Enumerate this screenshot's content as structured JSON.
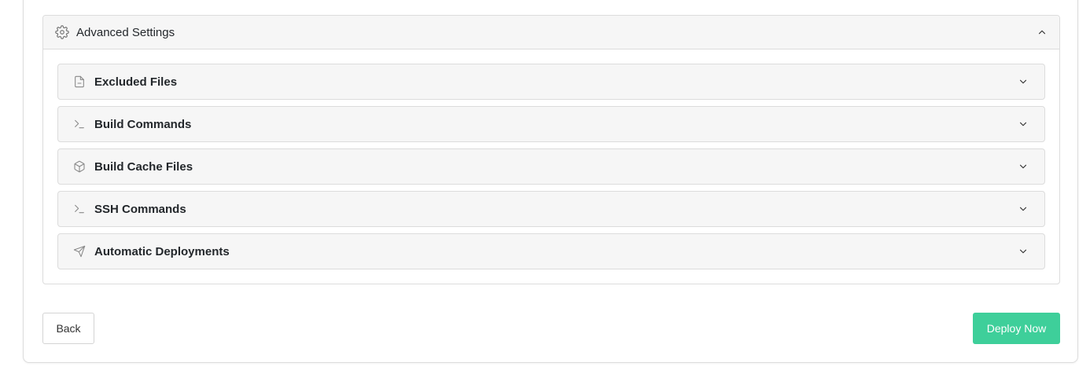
{
  "advanced": {
    "title": "Advanced Settings",
    "expanded": true,
    "sections": [
      {
        "label": "Excluded Files",
        "icon": "file-minus-icon"
      },
      {
        "label": "Build Commands",
        "icon": "terminal-icon"
      },
      {
        "label": "Build Cache Files",
        "icon": "package-icon"
      },
      {
        "label": "SSH Commands",
        "icon": "terminal-icon"
      },
      {
        "label": "Automatic Deployments",
        "icon": "send-icon"
      }
    ]
  },
  "footer": {
    "back_label": "Back",
    "deploy_label": "Deploy Now"
  },
  "colors": {
    "accent": "#3ecf9a",
    "panel_bg": "#f6f6f6",
    "border": "#dcdcdc"
  }
}
